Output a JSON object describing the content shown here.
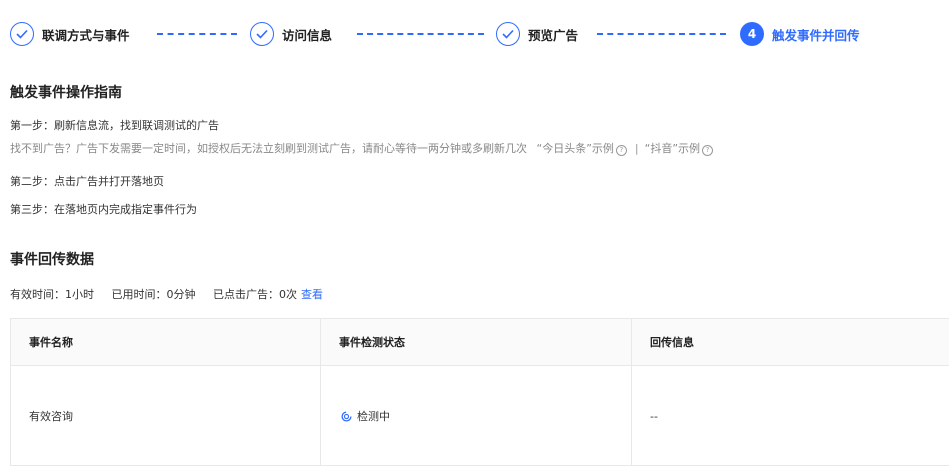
{
  "steps": [
    {
      "label": "联调方式与事件",
      "state": "done"
    },
    {
      "label": "访问信息",
      "state": "done"
    },
    {
      "label": "预览广告",
      "state": "done"
    },
    {
      "label": "触发事件并回传",
      "state": "active",
      "number": "4"
    }
  ],
  "guide": {
    "title": "触发事件操作指南",
    "step1": "第一步：刷新信息流，找到联调测试的广告",
    "tip_text": "找不到广告？广告下发需要一定时间，如授权后无法立刻刷到测试广告，请耐心等待一两分钟或多刷新几次",
    "example1": "“今日头条”示例",
    "separator": "|",
    "example2": "“抖音”示例",
    "help_icon": "question-circle-icon",
    "step2": "第二步：点击广告并打开落地页",
    "step3": "第三步：在落地页内完成指定事件行为"
  },
  "callback": {
    "title": "事件回传数据",
    "valid_time": "有效时间：1小时",
    "used_time": "已用时间：0分钟",
    "clicked": "已点击广告：0次",
    "view_link": "查看"
  },
  "table": {
    "headers": [
      "事件名称",
      "事件检测状态",
      "回传信息"
    ],
    "rows": [
      {
        "name": "有效咨询",
        "status": "检测中",
        "info": "--"
      }
    ]
  },
  "colors": {
    "accent": "#2f6bff"
  }
}
